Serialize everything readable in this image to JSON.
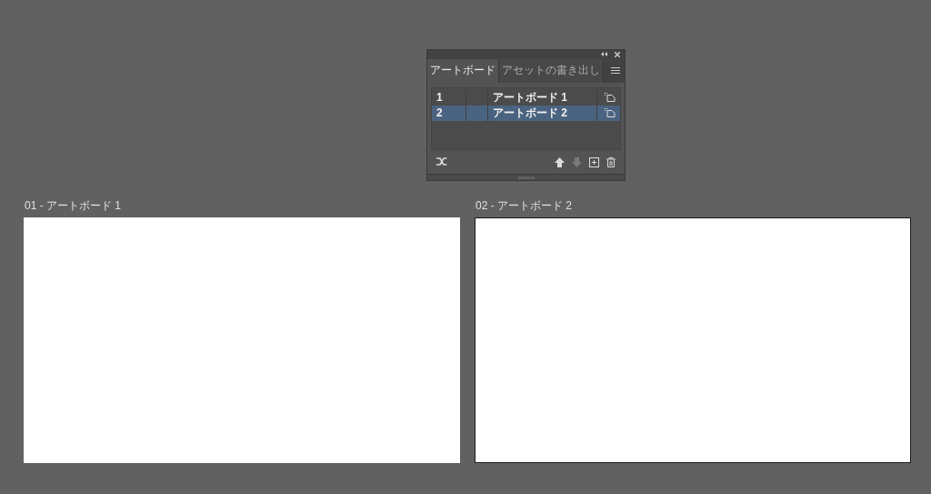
{
  "panel": {
    "tabs": [
      {
        "label": "アートボード",
        "selected": true
      },
      {
        "label": "アセットの書き出し",
        "selected": false
      }
    ],
    "rows": [
      {
        "number": "1",
        "name": "アートボード 1",
        "selected": false
      },
      {
        "number": "2",
        "name": "アートボード 2",
        "selected": true
      }
    ],
    "tools": [
      {
        "kind": "rearrange",
        "disabled": false
      },
      {
        "kind": "up",
        "disabled": false
      },
      {
        "kind": "down",
        "disabled": true
      },
      {
        "kind": "new",
        "disabled": false
      },
      {
        "kind": "delete",
        "disabled": false
      }
    ]
  },
  "artboards": [
    {
      "label": "01 - アートボード 1",
      "selected": false
    },
    {
      "label": "02 - アートボード 2",
      "selected": true
    }
  ]
}
